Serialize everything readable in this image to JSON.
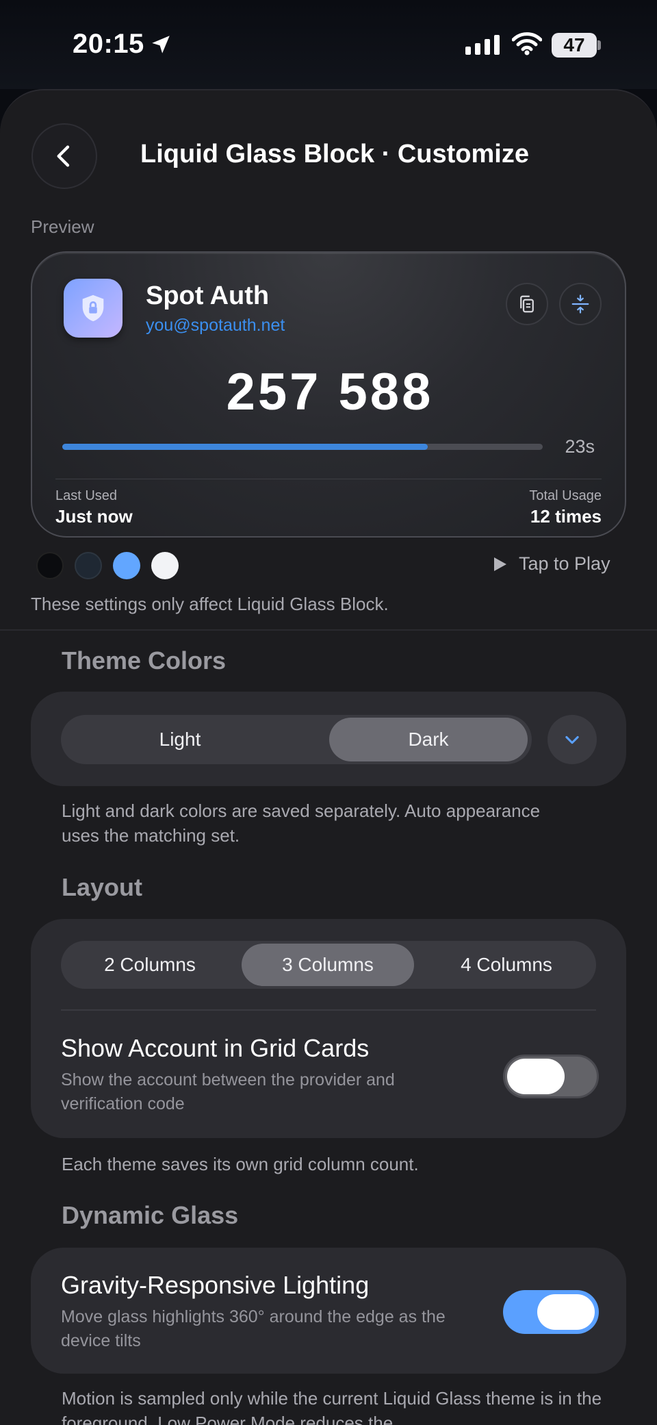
{
  "status_bar": {
    "time": "20:15",
    "battery": "47",
    "icons": [
      "location-arrow-icon",
      "cellular-signal-icon",
      "wifi-icon",
      "battery-icon"
    ]
  },
  "header": {
    "title": "Liquid Glass Block · Customize",
    "back_icon": "chevron-left-icon"
  },
  "preview": {
    "label": "Preview",
    "provider": "Spot Auth",
    "account": "you@spotauth.net",
    "code": "257 588",
    "seconds_left": "23s",
    "progress": 0.76,
    "last_used_label": "Last Used",
    "last_used_value": "Just now",
    "total_usage_label": "Total Usage",
    "total_usage_value": "12 times",
    "actions": [
      "copy-icon",
      "compress-icon"
    ],
    "swatches": [
      "#0b0c0f",
      "#1f2833",
      "#62a6ff",
      "#f2f3f6"
    ],
    "play_label": "Tap to Play",
    "note": "These settings only affect Liquid Glass Block."
  },
  "theme_colors": {
    "title": "Theme Colors",
    "options": [
      "Light",
      "Dark"
    ],
    "selected": "Dark",
    "note": "Light and dark colors are saved separately. Auto appearance uses the matching set."
  },
  "layout": {
    "title": "Layout",
    "options": [
      "2 Columns",
      "3 Columns",
      "4 Columns"
    ],
    "selected": "3 Columns",
    "show_account_title": "Show Account in Grid Cards",
    "show_account_sub": "Show the account between the provider and verification code",
    "show_account_on": false,
    "note": "Each theme saves its own grid column count."
  },
  "dynamic_glass": {
    "title": "Dynamic Glass",
    "gravity_title": "Gravity-Responsive Lighting",
    "gravity_sub": "Move glass highlights 360° around the edge as the device tilts",
    "gravity_on": true,
    "note": "Motion is sampled only while the current Liquid Glass theme is in the foreground. Low Power Mode reduces the"
  },
  "colors": {
    "accent_blue": "#3b8ff0",
    "toggle_on": "#5aa0ff",
    "toggle_off": "#636368"
  }
}
